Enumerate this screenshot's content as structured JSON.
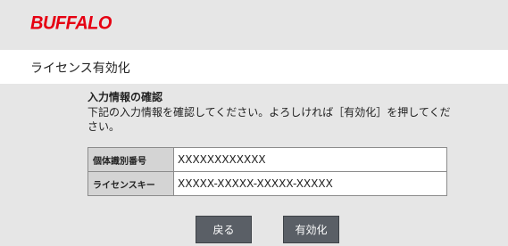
{
  "brand": {
    "logo_text": "BUFFALO",
    "logo_color": "#e60012"
  },
  "page": {
    "title": "ライセンス有効化"
  },
  "confirm": {
    "heading": "入力情報の確認",
    "description": "下記の入力情報を確認してください。よろしければ［有効化］を押してください。"
  },
  "info_table": {
    "rows": [
      {
        "label": "個体識別番号",
        "value": "XXXXXXXXXXXX"
      },
      {
        "label": "ライセンスキー",
        "value": "XXXXX-XXXXX-XXXXX-XXXXX"
      }
    ]
  },
  "buttons": {
    "back_label": "戻る",
    "enable_label": "有効化"
  },
  "colors": {
    "button_bg": "#5a5f66",
    "header_bg": "#e6e6e6"
  }
}
